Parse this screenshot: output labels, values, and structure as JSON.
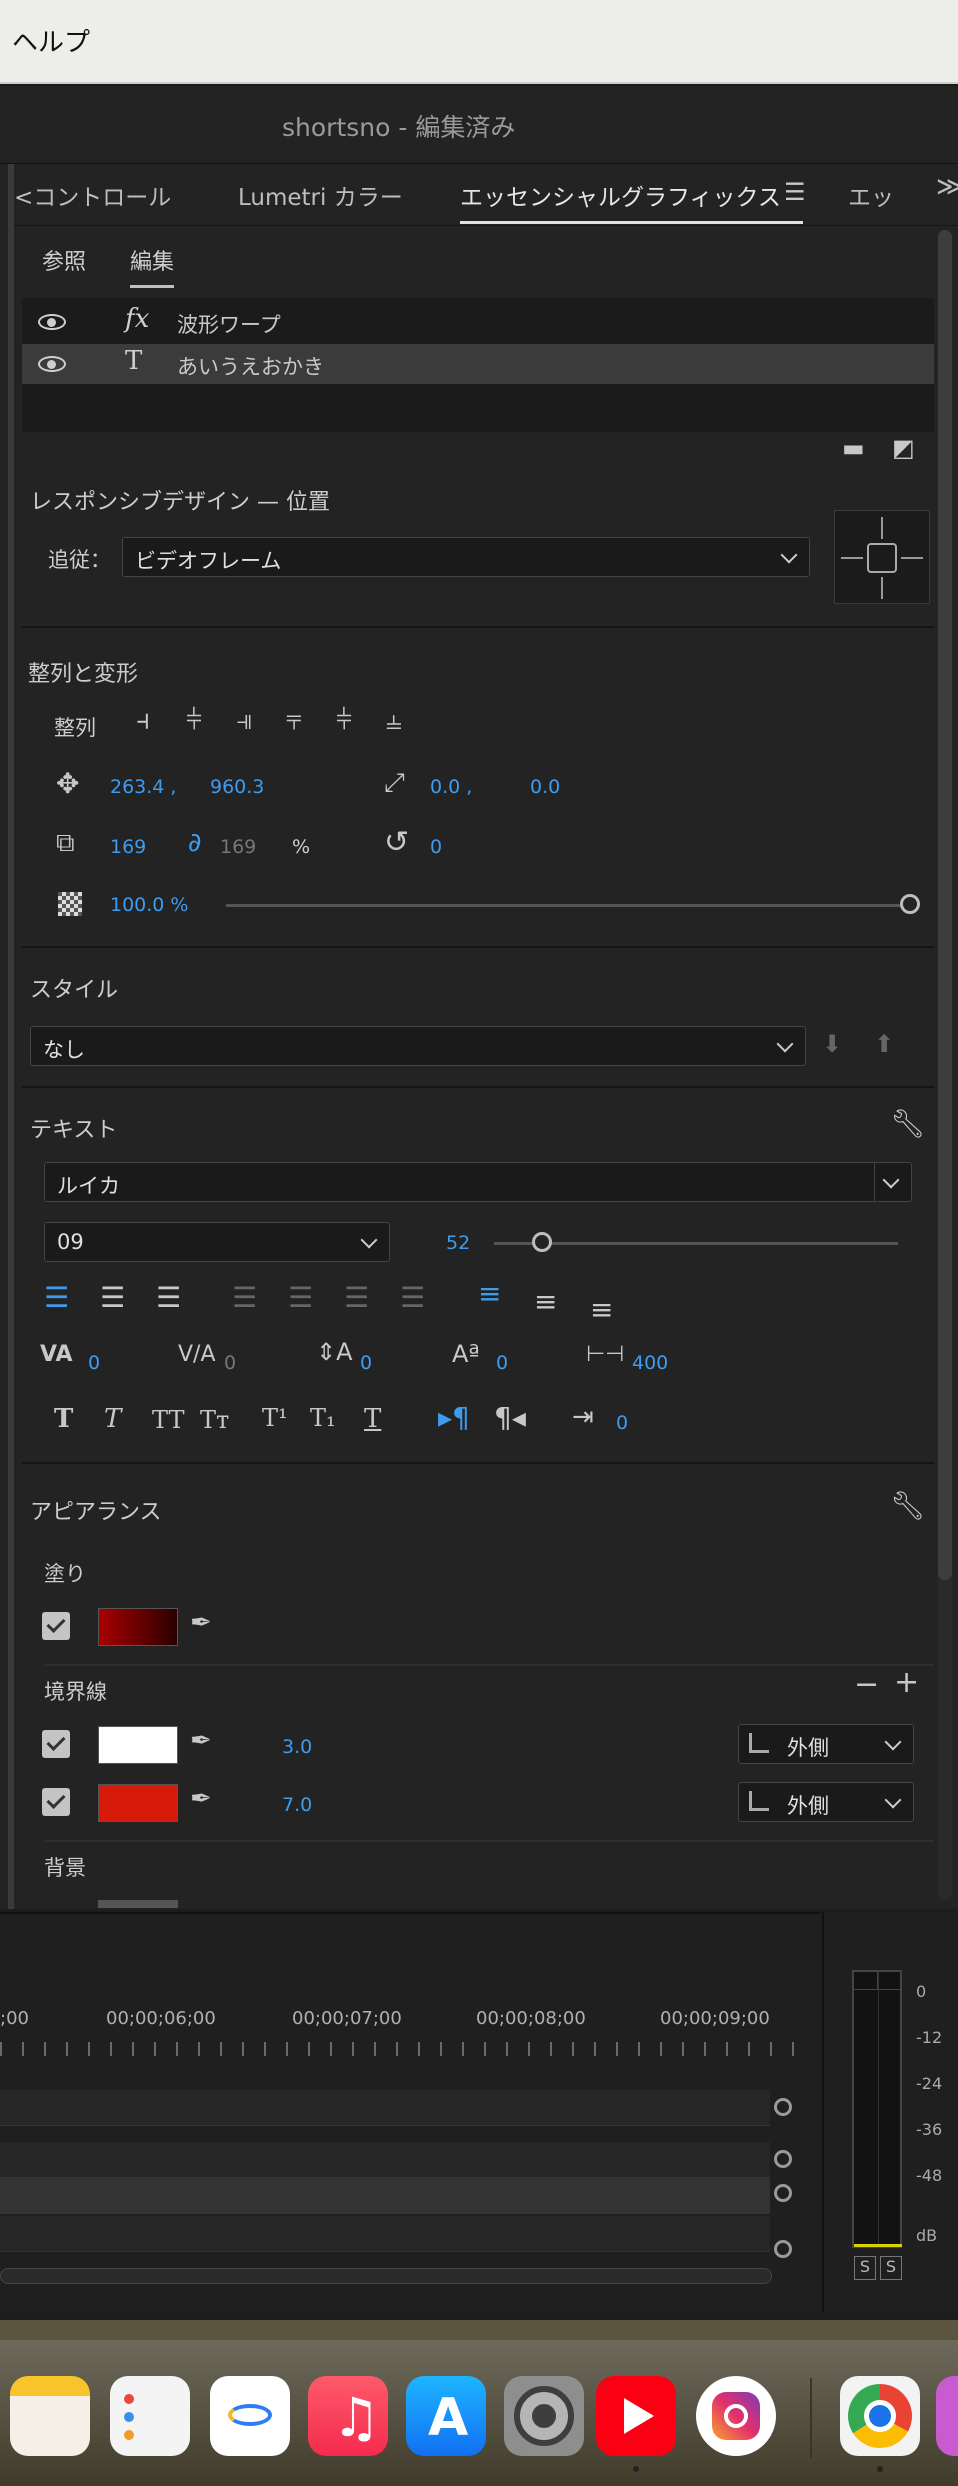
{
  "menubar": {
    "help": "ヘルプ"
  },
  "window": {
    "title": "shortsno - 編集済み"
  },
  "tabs": {
    "t1": "<コントロール",
    "t2": "Lumetri カラー",
    "t3": "エッセンシャルグラフィックス",
    "t4": "エッ",
    "overflow": "≫"
  },
  "subtabs": {
    "browse": "参照",
    "edit": "編集"
  },
  "layers": [
    {
      "icon": "fx",
      "label": "波形ワープ"
    },
    {
      "icon": "T",
      "label": "あいうえおかき"
    }
  ],
  "responsive": {
    "title": "レスポンシブデザイン — 位置",
    "follow_label": "追従：",
    "follow_value": "ビデオフレーム"
  },
  "align": {
    "title": "整列と変形",
    "align_label": "整列",
    "pos_x": "263.4 ,",
    "pos_y": "960.3",
    "anchor_x": "0.0 ,",
    "anchor_y": "0.0",
    "scale": "169",
    "scale_linked": "169",
    "percent": "%",
    "rotation": "0",
    "opacity": "100.0 %",
    "opacity_fraction": 1.0
  },
  "style": {
    "title": "スタイル",
    "value": "なし"
  },
  "text": {
    "title": "テキスト",
    "font": "ルイカ",
    "font_style": "09",
    "size": "52",
    "size_fraction": 0.12,
    "kerning": "0",
    "tracking": "0",
    "leading": "0",
    "baseline": "0",
    "tsume": "400",
    "tab_width": "0"
  },
  "appearance": {
    "title": "アピアランス",
    "fill_label": "塗り",
    "stroke_label": "境界線",
    "stroke1_width": "3.0",
    "stroke1_pos": "外側",
    "stroke2_width": "7.0",
    "stroke2_pos": "外側",
    "bg_label": "背景",
    "fill_color": "#a80000",
    "stroke1_color": "#ffffff",
    "stroke2_color": "#d81a0a"
  },
  "timeline": {
    "ticks": [
      ";00",
      "00;00;06;00",
      "00;00;07;00",
      "00;00;08;00",
      "00;00;09;00"
    ]
  },
  "meter": {
    "scale": [
      "0",
      "-12",
      "-24",
      "-36",
      "-48",
      "dB"
    ],
    "solo": "S"
  }
}
